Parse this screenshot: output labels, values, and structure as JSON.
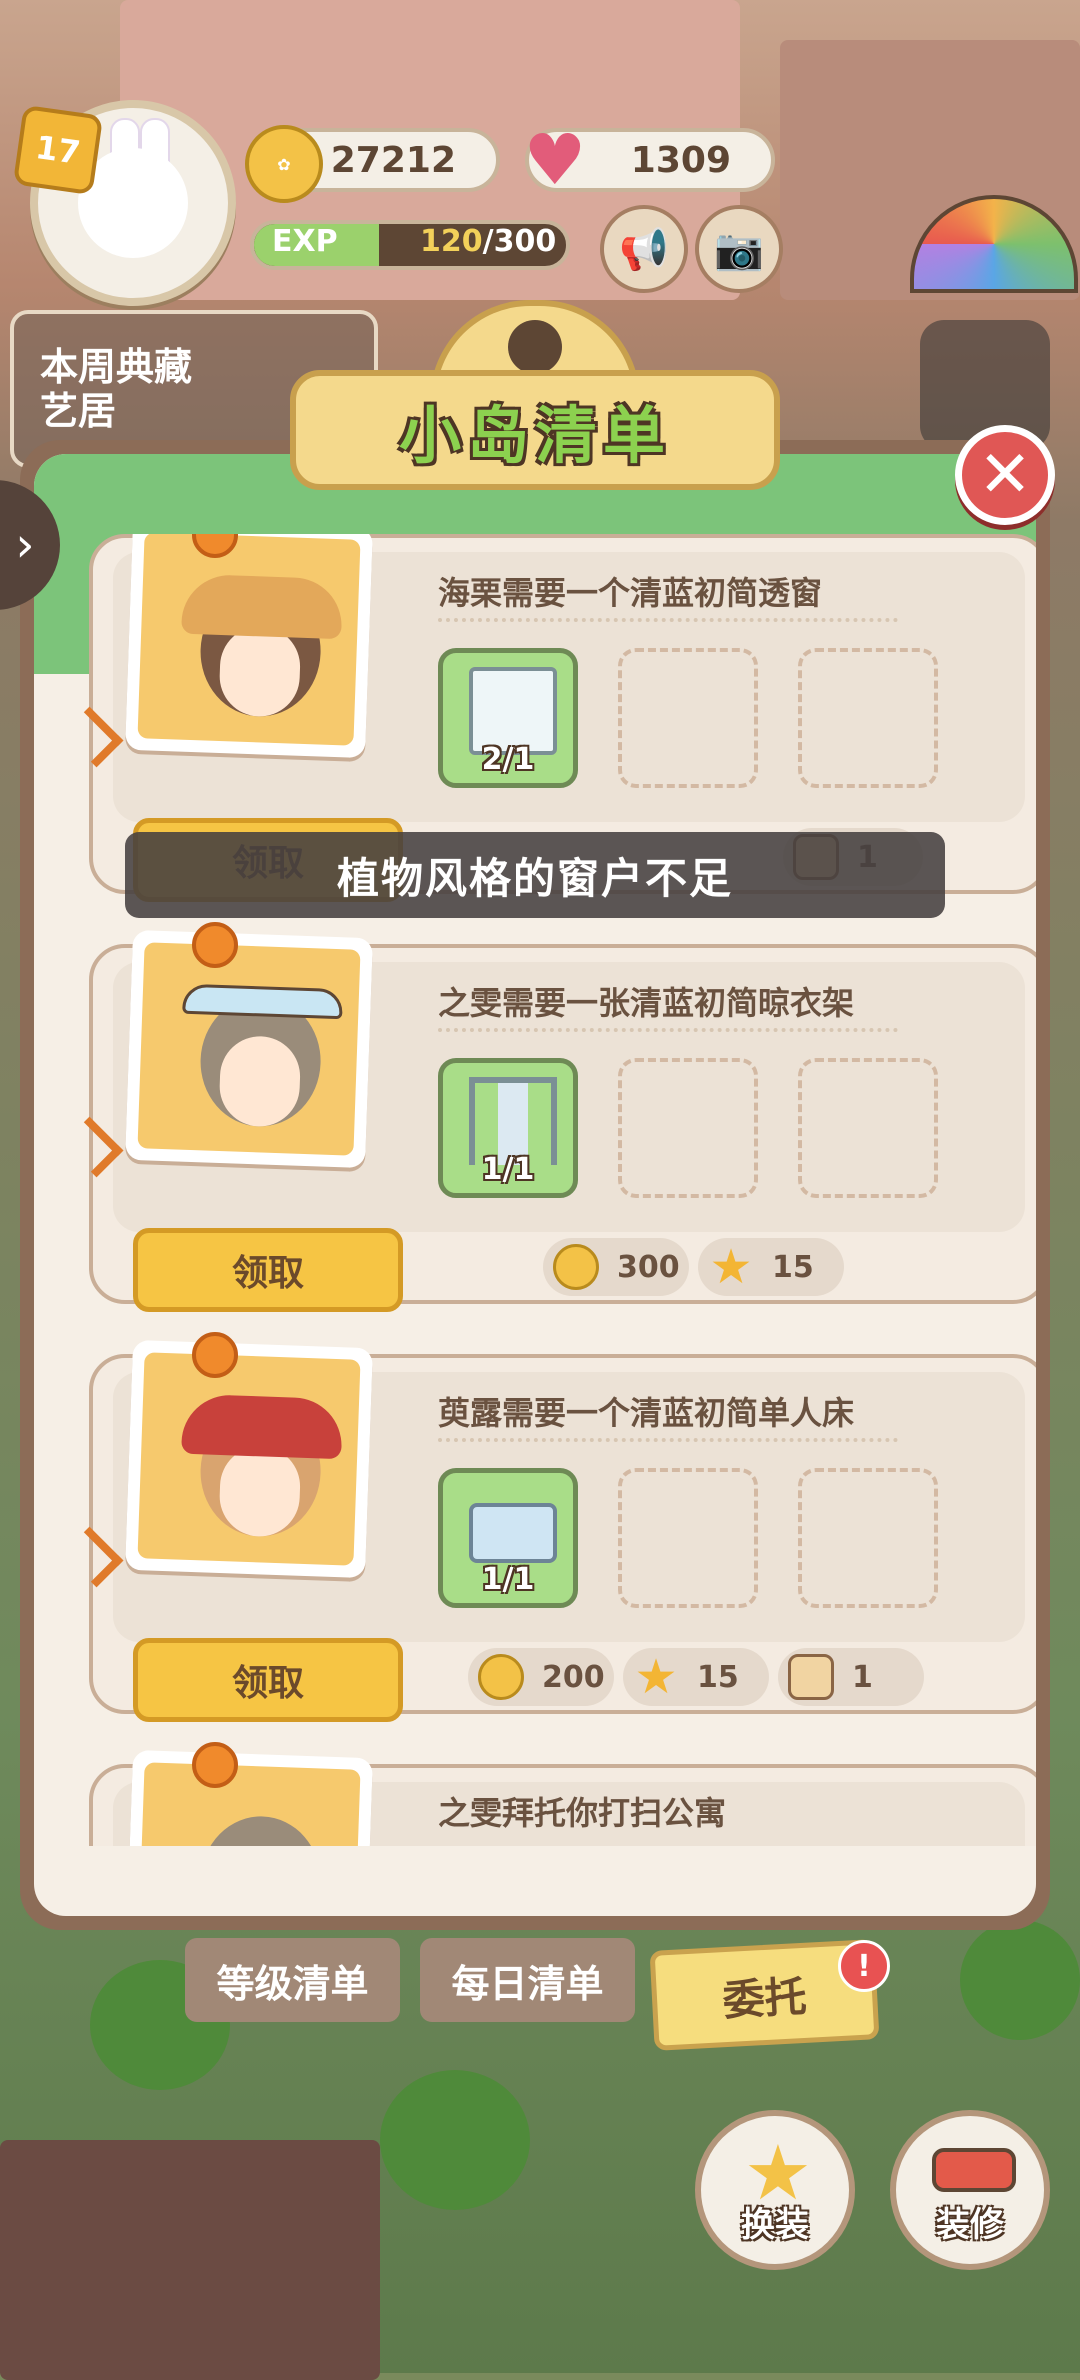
{
  "hud": {
    "level": "17",
    "coins": "27212",
    "hearts": "1309",
    "exp_label": "EXP",
    "exp_current": "120",
    "exp_max": "/300",
    "exp_progress": 0.4,
    "weekly_card": "本周典藏艺居"
  },
  "panel": {
    "title": "小岛清单",
    "close_glyph": "✕"
  },
  "toast": "植物风格的窗户不足",
  "orders": [
    {
      "request": "海栗需要一个清蓝初简透窗",
      "item_count": "2/1",
      "item_icon": "window-icon",
      "claim_label": "领取",
      "rewards": [
        {
          "icon": "box",
          "value": "1"
        }
      ]
    },
    {
      "request": "之雯需要一张清蓝初简晾衣架",
      "item_count": "1/1",
      "item_icon": "clothes-rack-icon",
      "claim_label": "领取",
      "rewards": [
        {
          "icon": "coin",
          "value": "300"
        },
        {
          "icon": "star",
          "value": "15"
        }
      ]
    },
    {
      "request": "萸露需要一个清蓝初简单人床",
      "item_count": "1/1",
      "item_icon": "bed-icon",
      "claim_label": "领取",
      "rewards": [
        {
          "icon": "coin",
          "value": "200"
        },
        {
          "icon": "star",
          "value": "15"
        },
        {
          "icon": "box",
          "value": "1"
        }
      ]
    },
    {
      "request": "之雯拜托你打扫公寓"
    }
  ],
  "tabs": {
    "level_list": "等级清单",
    "daily_list": "每日清单",
    "commission": "委托",
    "commission_badge": "!"
  },
  "actions": {
    "dress_up": "换装",
    "renovate": "装修"
  },
  "colors": {
    "accent_green": "#7cc47a",
    "claim_yellow": "#f6c544",
    "close_red": "#e05755"
  }
}
